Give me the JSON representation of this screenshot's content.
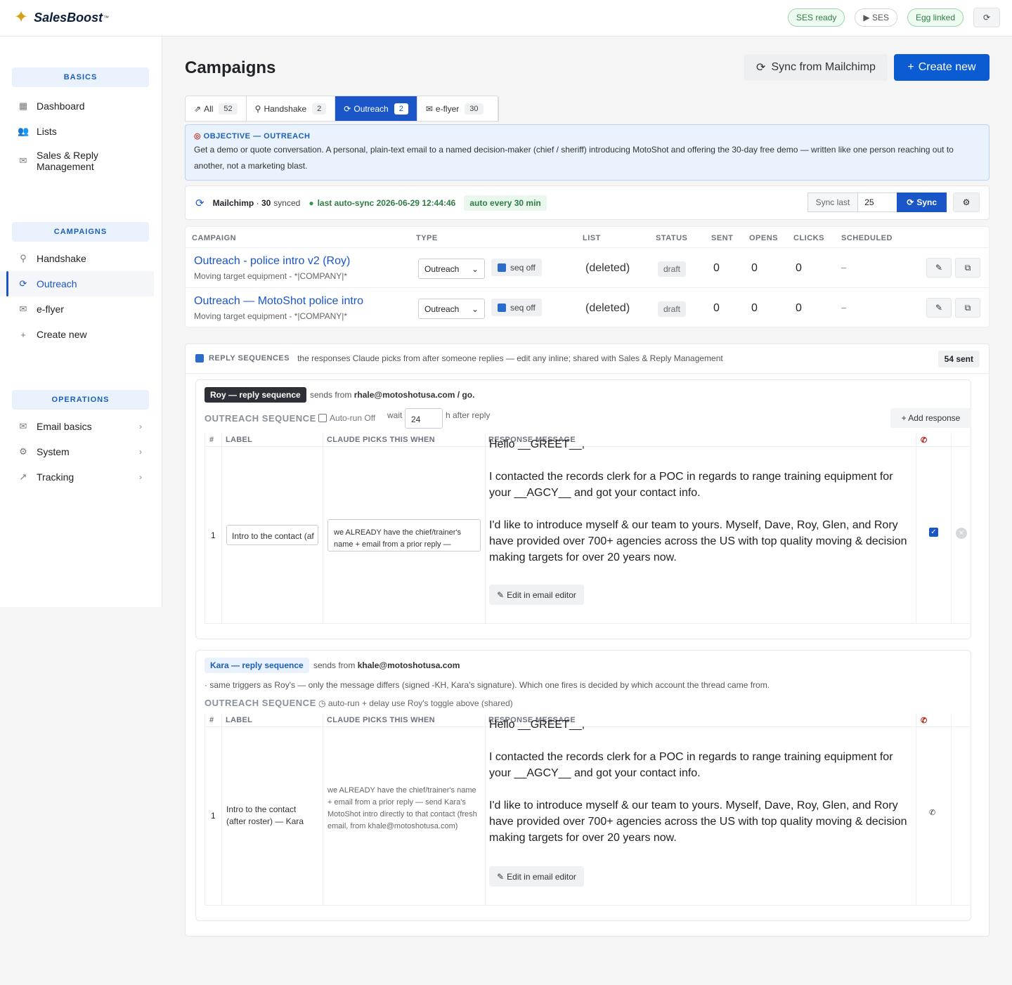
{
  "app": {
    "name": "SalesBoost",
    "tm": "™"
  },
  "topbar": {
    "ses_ready": "SES ready",
    "ses_play": "▶ SES",
    "egg": "Egg linked",
    "refresh": "⟳"
  },
  "sidebar": {
    "sections": [
      {
        "title": "BASICS",
        "items": [
          {
            "label": "Dashboard",
            "icon": "grid-icon"
          },
          {
            "label": "Lists",
            "icon": "users-icon"
          },
          {
            "label": "Sales & Reply Management",
            "icon": "mail-search-icon"
          }
        ]
      },
      {
        "title": "CAMPAIGNS",
        "items": [
          {
            "label": "Handshake",
            "icon": "handshake-icon"
          },
          {
            "label": "Outreach",
            "icon": "sync-icon",
            "active": true
          },
          {
            "label": "e-flyer",
            "icon": "envelope-icon"
          },
          {
            "label": "Create new",
            "icon": "plus-icon"
          }
        ]
      },
      {
        "title": "OPERATIONS",
        "items": [
          {
            "label": "Email basics",
            "icon": "mail-icon"
          },
          {
            "label": "System",
            "icon": "gear-icon"
          },
          {
            "label": "Tracking",
            "icon": "chart-icon"
          }
        ]
      }
    ]
  },
  "page": {
    "title": "Campaigns",
    "sync_btn": "Sync from Mailchimp",
    "create_btn": "Create new"
  },
  "tabs": [
    {
      "label": "All",
      "count": "52",
      "icon": "⇗"
    },
    {
      "label": "Handshake",
      "count": "2",
      "icon": "⚲"
    },
    {
      "label": "Outreach",
      "count": "2",
      "icon": "⟳",
      "active": true
    },
    {
      "label": "e-flyer",
      "count": "30",
      "icon": "✉"
    }
  ],
  "objective": {
    "title": "OBJECTIVE — OUTREACH",
    "text": "Get a demo or quote conversation. A personal, plain-text email to a named decision-maker (chief / sheriff) introducing MotoShot and offering the 30-day free demo — written like one person reaching out to another, not a marketing blast."
  },
  "syncbar": {
    "source": "Mailchimp",
    "count": "30",
    "synced": "synced",
    "last": "last auto-sync 2026-06-29 12:44:46",
    "auto": "auto every 30 min",
    "sync_last_label": "Sync last",
    "sync_last_value": "25",
    "sync_btn": "Sync"
  },
  "campaign_table": {
    "headers": [
      "CAMPAIGN",
      "TYPE",
      "LIST",
      "STATUS",
      "SENT",
      "OPENS",
      "CLICKS",
      "SCHEDULED"
    ],
    "rows": [
      {
        "name": "Outreach - police intro v2 (Roy)",
        "subject": "Moving target equipment - *|COMPANY|*",
        "type": "Outreach",
        "seq": "seq off",
        "list": "(deleted)",
        "status": "draft",
        "sent": "0",
        "opens": "0",
        "clicks": "0",
        "scheduled": "–"
      },
      {
        "name": "Outreach — MotoShot police intro",
        "subject": "Moving target equipment - *|COMPANY|*",
        "type": "Outreach",
        "seq": "seq off",
        "list": "(deleted)",
        "status": "draft",
        "sent": "0",
        "opens": "0",
        "clicks": "0",
        "scheduled": "–"
      }
    ]
  },
  "reply_sequences": {
    "title": "REPLY SEQUENCES",
    "desc": "the responses Claude picks from after someone replies — edit any inline; shared with Sales & Reply Management",
    "sent": "54 sent",
    "roy": {
      "tag": "Roy — reply sequence",
      "from_label": "sends from",
      "from": "rhale@motoshotusa.com / go.",
      "os_title": "OUTREACH SEQUENCE",
      "autorun": "Auto-run Off",
      "wait": "wait",
      "wait_value": "24",
      "after": "h after reply",
      "add": "+ Add response",
      "headers": [
        "#",
        "LABEL",
        "CLAUDE PICKS THIS WHEN",
        "RESPONSE MESSAGE"
      ],
      "row": {
        "num": "1",
        "label": "Intro to the contact (af",
        "when": "we ALREADY have the chief/trainer's name + email from a prior reply —",
        "msg1": "Hello __GREET__,",
        "msg2": "I contacted the records clerk for a POC in regards to range training equipment for your __AGCY__ and got your contact info.",
        "msg3": "I'd like to introduce myself & our team to yours. Myself, Dave, Roy, Glen, and Rory have provided over 700+ agencies across the US with top quality moving & decision making targets for over 20 years now.",
        "edit": "Edit in email editor"
      }
    },
    "kara": {
      "tag": "Kara — reply sequence",
      "from_label": "sends from",
      "from": "khale@motoshotusa.com",
      "note": "· same triggers as Roy's — only the message differs (signed -KH, Kara's signature). Which one fires is decided by which account the thread came from.",
      "os_title": "OUTREACH SEQUENCE",
      "autorun_note": "auto-run + delay use Roy's toggle above (shared)",
      "headers": [
        "#",
        "LABEL",
        "CLAUDE PICKS THIS WHEN",
        "RESPONSE MESSAGE"
      ],
      "row": {
        "num": "1",
        "label": "Intro to the contact (after roster) — Kara",
        "when": "we ALREADY have the chief/trainer's name + email from a prior reply — send Kara's MotoShot intro directly to that contact (fresh email, from khale@motoshotusa.com)",
        "msg1": "Hello __GREET__,",
        "msg2": "I contacted the records clerk for a POC in regards to range training equipment for your __AGCY__ and got your contact info.",
        "msg3": "I'd like to introduce myself & our team to yours. Myself, Dave, Roy, Glen, and Rory have provided over 700+ agencies across the US with top quality moving & decision making targets for over 20 years now.",
        "edit": "Edit in email editor"
      }
    }
  },
  "colors": {
    "accent": "#1a56c7",
    "green": "#2e7d44",
    "phone_red": "#b42318"
  }
}
